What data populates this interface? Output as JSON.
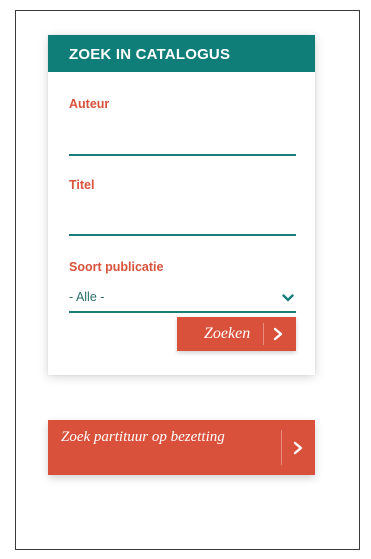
{
  "catalog_search": {
    "title": "ZOEK IN CATALOGUS",
    "fields": {
      "author": {
        "label": "Auteur",
        "value": ""
      },
      "title": {
        "label": "Titel",
        "value": ""
      },
      "publication_type": {
        "label": "Soort publicatie",
        "selected": "- Alle -"
      }
    },
    "submit_label": "Zoeken"
  },
  "score_search": {
    "label": "Zoek partituur op bezetting"
  },
  "icons": {
    "select": "chevron-down-icon",
    "submit": "chevron-right-icon",
    "score": "chevron-right-icon"
  },
  "colors": {
    "header_bg": "#0f7d78",
    "accent": "#d9513a",
    "label": "#d9523b",
    "underline": "#1a7f7a"
  }
}
